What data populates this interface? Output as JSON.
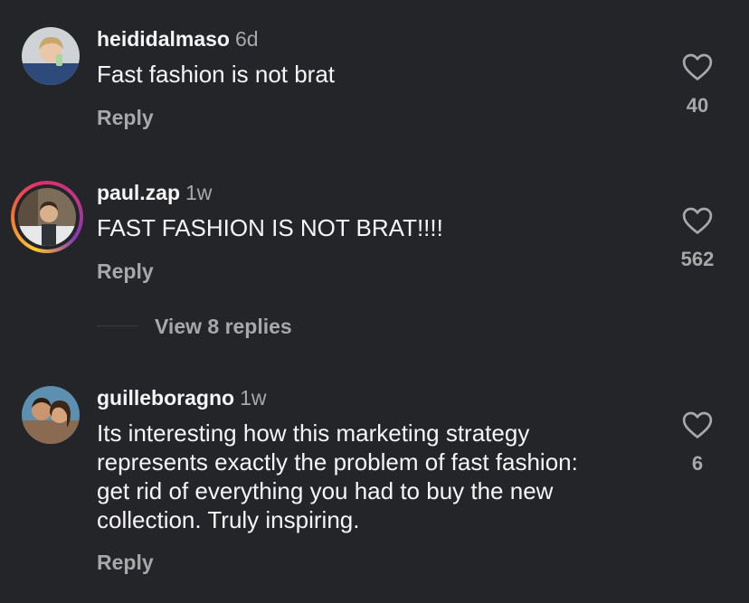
{
  "comments": [
    {
      "username": "heididalmaso",
      "time": "6d",
      "text": "Fast fashion is not brat",
      "reply_label": "Reply",
      "likes": "40",
      "avatar_icon": "avatar-photo-icon",
      "has_story_ring": false
    },
    {
      "username": "paul.zap",
      "time": "1w",
      "text": "FAST FASHION IS NOT BRAT!!!!",
      "reply_label": "Reply",
      "likes": "562",
      "avatar_icon": "avatar-photo-icon",
      "has_story_ring": true,
      "view_replies_label": "View 8 replies"
    },
    {
      "username": "guilleboragno",
      "time": "1w",
      "text_lines": [
        "Its interesting how this marketing strategy",
        "represents exactly the problem of fast fashion:",
        "get rid of everything you had to buy the new",
        "collection. Truly inspiring."
      ],
      "reply_label": "Reply",
      "likes": "6",
      "avatar_icon": "avatar-photo-icon",
      "has_story_ring": false
    }
  ],
  "colors": {
    "background": "#232529",
    "primary_text": "#f5f5f5",
    "secondary_text": "#a8a8a8"
  },
  "icons": {
    "like": "heart-outline-icon"
  }
}
